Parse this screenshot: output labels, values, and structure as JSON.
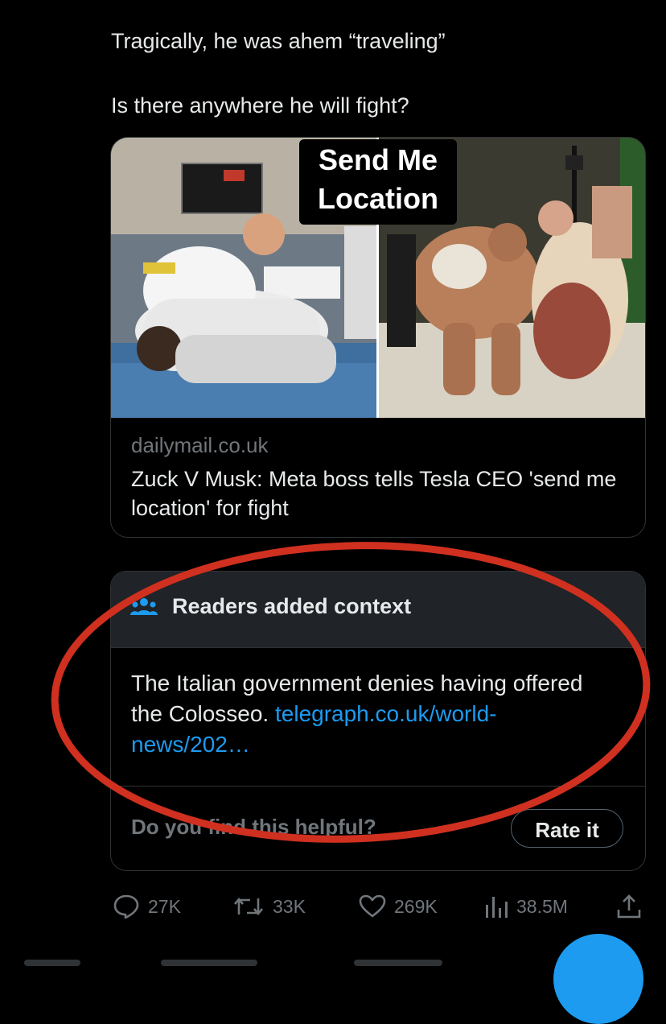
{
  "tweet": {
    "line1": "Tragically, he was ahem “traveling”",
    "line2": "Is there anywhere he will fight?"
  },
  "link_card": {
    "overlay_text": "Send Me Location",
    "domain": "dailymail.co.uk",
    "headline": "Zuck V Musk: Meta boss tells Tesla CEO 'send me location' for fight"
  },
  "context": {
    "title": "Readers added context",
    "body": "The Italian government denies having offered the Colosseo.",
    "link": "telegraph.co.uk/world-news/202…",
    "helpful_question": "Do you find this helpful?",
    "rate_label": "Rate it"
  },
  "actions": {
    "replies": "27K",
    "retweets": "33K",
    "likes": "269K",
    "views": "38.5M"
  },
  "colors": {
    "background": "#000000",
    "accent": "#1d9bf0",
    "annotation": "#d0301f",
    "muted": "#71767b"
  },
  "icons": [
    "people-icon",
    "reply-icon",
    "retweet-icon",
    "like-icon",
    "views-icon",
    "share-icon"
  ]
}
